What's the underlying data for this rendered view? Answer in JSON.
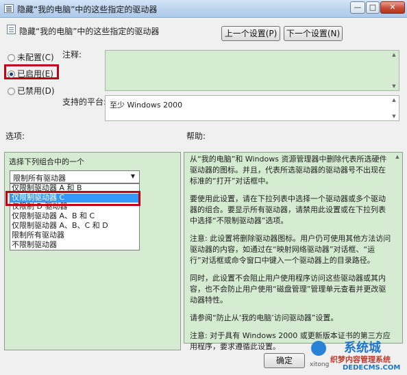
{
  "window": {
    "title": "隐藏“我的电脑”中的这些指定的驱动器",
    "controls": {
      "minimize": "—",
      "maximize": "□",
      "close": "✕"
    }
  },
  "header": {
    "setting_title": "隐藏“我的电脑”中的这些指定的驱动器",
    "prev_button": "上一个设置(P)",
    "next_button": "下一个设置(N)"
  },
  "state": {
    "options": [
      {
        "label": "未配置(C)",
        "selected": false
      },
      {
        "label": "已启用(E)",
        "selected": true
      },
      {
        "label": "已禁用(D)",
        "selected": false
      }
    ]
  },
  "comment": {
    "label": "注释:"
  },
  "platform": {
    "label": "支持的平台:",
    "value": "至少 Windows 2000"
  },
  "options_section": {
    "label": "选项:",
    "combo_label": "选择下列组合中的一个",
    "selected": "限制所有驱动器",
    "list": [
      "仅限制驱动器 A 和 B",
      "仅限制驱动器 C",
      "仅限制 D 驱动器",
      "仅限制驱动器 A、B 和 C",
      "仅限制驱动器 A、B、C 和 D",
      "限制所有驱动器",
      "不限制驱动器"
    ],
    "highlighted_index": 1
  },
  "help_section": {
    "label": "帮助:",
    "paragraphs": [
      "从“我的电脑”和 Windows 资源管理器中删除代表所选硬件驱动器的图标。并且，代表所选驱动器的驱动器号不出现在标准的“打开”对话框中。",
      "要使用此设置，请在下拉列表中选择一个驱动器或多个驱动器的组合。要显示所有驱动器，请禁用此设置或在下拉列表中选择“不限制驱动器”选项。",
      "注意: 此设置将删除驱动器图标。用户仍可使用其他方法访问驱动器的内容，如通过在“映射网络驱动器”对话框、“运行”对话框或命令窗口中键入一个驱动器上的目录路径。",
      "同时，此设置不会阻止用户使用程序访问这些驱动器或其内容，也不会防止用户使用“磁盘管理”管理单元查看并更改驱动器特性。",
      "请参阅“防止从‘我的电脑’访问驱动器”设置。",
      "注意: 对于具有 Windows 2000 或更新版本证书的第三方应用程序，要求遵循此设置。"
    ]
  },
  "footer": {
    "ok_button": "确定"
  },
  "watermark": {
    "top": "系统城",
    "mid": "织梦内容管理系统",
    "bottom": "DEDECMS.COM",
    "left_fragment": "xitong"
  }
}
